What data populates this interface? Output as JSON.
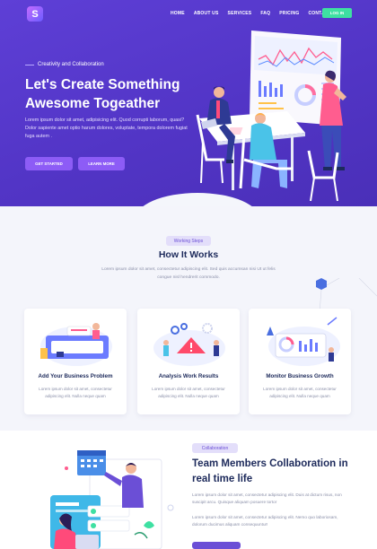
{
  "nav": {
    "logo_letter": "S",
    "items": [
      "HOME",
      "ABOUT US",
      "SERVICES",
      "FAQ",
      "PRICING",
      "CONTACT"
    ],
    "login_label": "LOG IN"
  },
  "hero": {
    "eyebrow": "Creativity and Collaboration",
    "title": "Let's Create Something Awesome Togeather",
    "text": "Lorem ipsum dolor sit amet, adipisicing elit. Quod corrupti laborum, quasi? Dolor sapiente amet optio harum dolores, voluptate, tempora dolorem fugiat fuga autem .",
    "primary_button": "GET STARTED",
    "secondary_button": "LEARN MORE"
  },
  "how": {
    "pill": "Working Steps",
    "title": "How It Works",
    "subtitle": "Lorem ipsum dolor sit amet, consectetur adipiscing elit. Sed quis accumsan nisi Ut ut felis congue nisl hendrerit commodo.",
    "cards": [
      {
        "title": "Add Your Business Problem",
        "desc": "Lorem ipsum dolor sit amet, consectetur adipiscing elit. Nulla neque quam"
      },
      {
        "title": "Analysis Work Results",
        "desc": "Lorem ipsum dolor sit amet, consectetur adipiscing elit. Nulla neque quam"
      },
      {
        "title": "Monitor Business Growth",
        "desc": "Lorem ipsum dolor sit amet, consectetur adipiscing elit. Nulla neque quam"
      }
    ]
  },
  "collab": {
    "pill": "Collaboration",
    "title": "Team Members Collaboration in real time life",
    "p1": "Lorem ipsum dolor sit amet, consectetur adipiscing elit. Duis at dictum risus, non suscipit arcu. Quisque aliquam posuere tortor",
    "p2": "Lorem ipsum dolor sit amet, consectetur adipiscing elit. Nemo quo laboriosam, dolorum ducimus aliquam consequuntur!"
  },
  "colors": {
    "hero_bg": "#5235c6",
    "accent": "#3ee0a2",
    "button_purple": "#8d5cf6",
    "heading": "#1d2a5b"
  },
  "icons": [
    "logo-icon",
    "dashboard-illustration",
    "team-meeting-illustration",
    "calendar-icon",
    "hexagon-icon"
  ]
}
